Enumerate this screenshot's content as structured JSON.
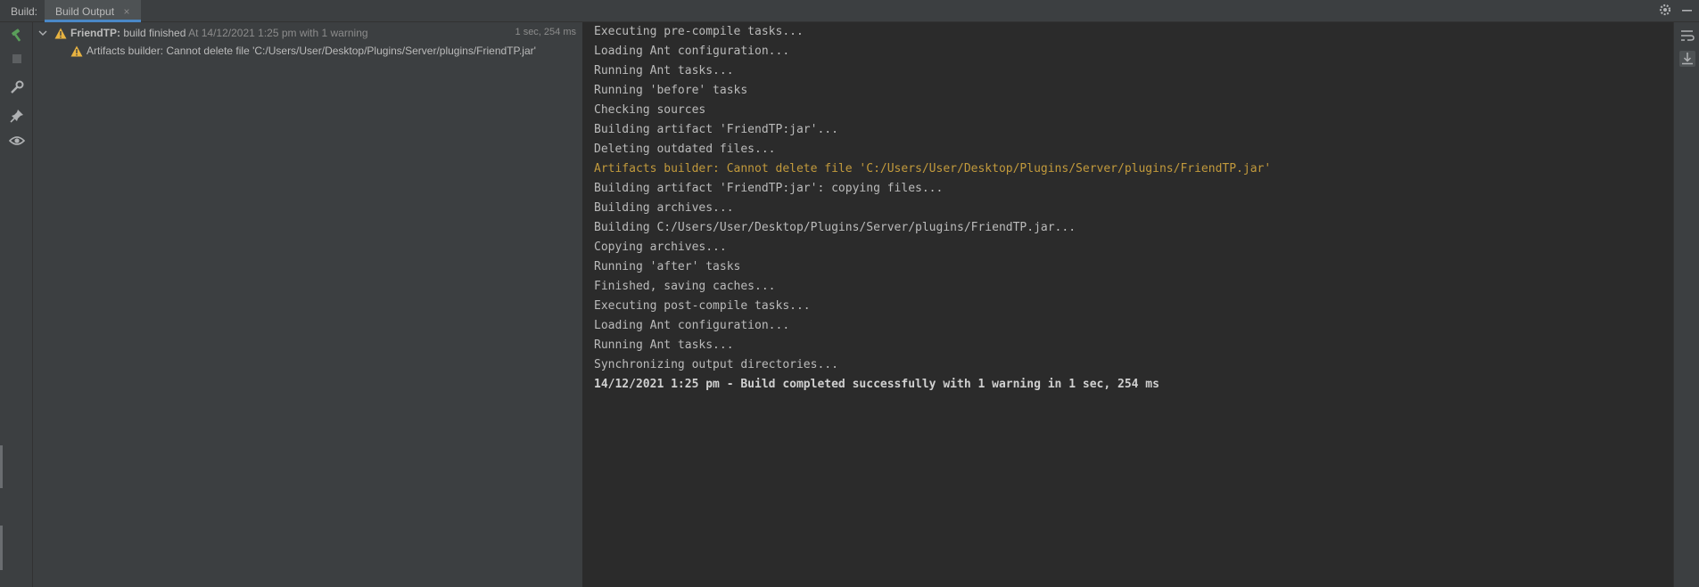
{
  "header": {
    "build_label": "Build:",
    "tab_label": "Build Output",
    "tab_close": "×"
  },
  "colors": {
    "accent": "#4a88c7",
    "warning": "#c29a3c",
    "hammer": "#5a9e5a"
  },
  "toolbar_left": [
    "hammer-icon",
    "stop-icon",
    "wrench-icon",
    "pin-icon",
    "eye-icon"
  ],
  "toolbar_right": [
    "soft-wrap-icon",
    "scroll-to-end-icon"
  ],
  "tree": {
    "root": {
      "project": "FriendTP:",
      "status": "build finished",
      "meta": "At 14/12/2021 1:25 pm with 1 warning",
      "duration": "1 sec, 254 ms"
    },
    "children": [
      {
        "text": "Artifacts builder: Cannot delete file 'C:/Users/User/Desktop/Plugins/Server/plugins/FriendTP.jar'"
      }
    ]
  },
  "console": {
    "lines": [
      "Executing pre-compile tasks...",
      "Loading Ant configuration...",
      "Running Ant tasks...",
      "Running 'before' tasks",
      "Checking sources",
      "Building artifact 'FriendTP:jar'...",
      "Deleting outdated files...",
      "Artifacts builder: Cannot delete file 'C:/Users/User/Desktop/Plugins/Server/plugins/FriendTP.jar'",
      "Building artifact 'FriendTP:jar': copying files...",
      "Building archives...",
      "Building C:/Users/User/Desktop/Plugins/Server/plugins/FriendTP.jar...",
      "Copying archives...",
      "Running 'after' tasks",
      "Finished, saving caches...",
      "Executing post-compile tasks...",
      "Loading Ant configuration...",
      "Running Ant tasks...",
      "Synchronizing output directories...",
      "14/12/2021 1:25 pm - Build completed successfully with 1 warning in 1 sec, 254 ms"
    ]
  }
}
